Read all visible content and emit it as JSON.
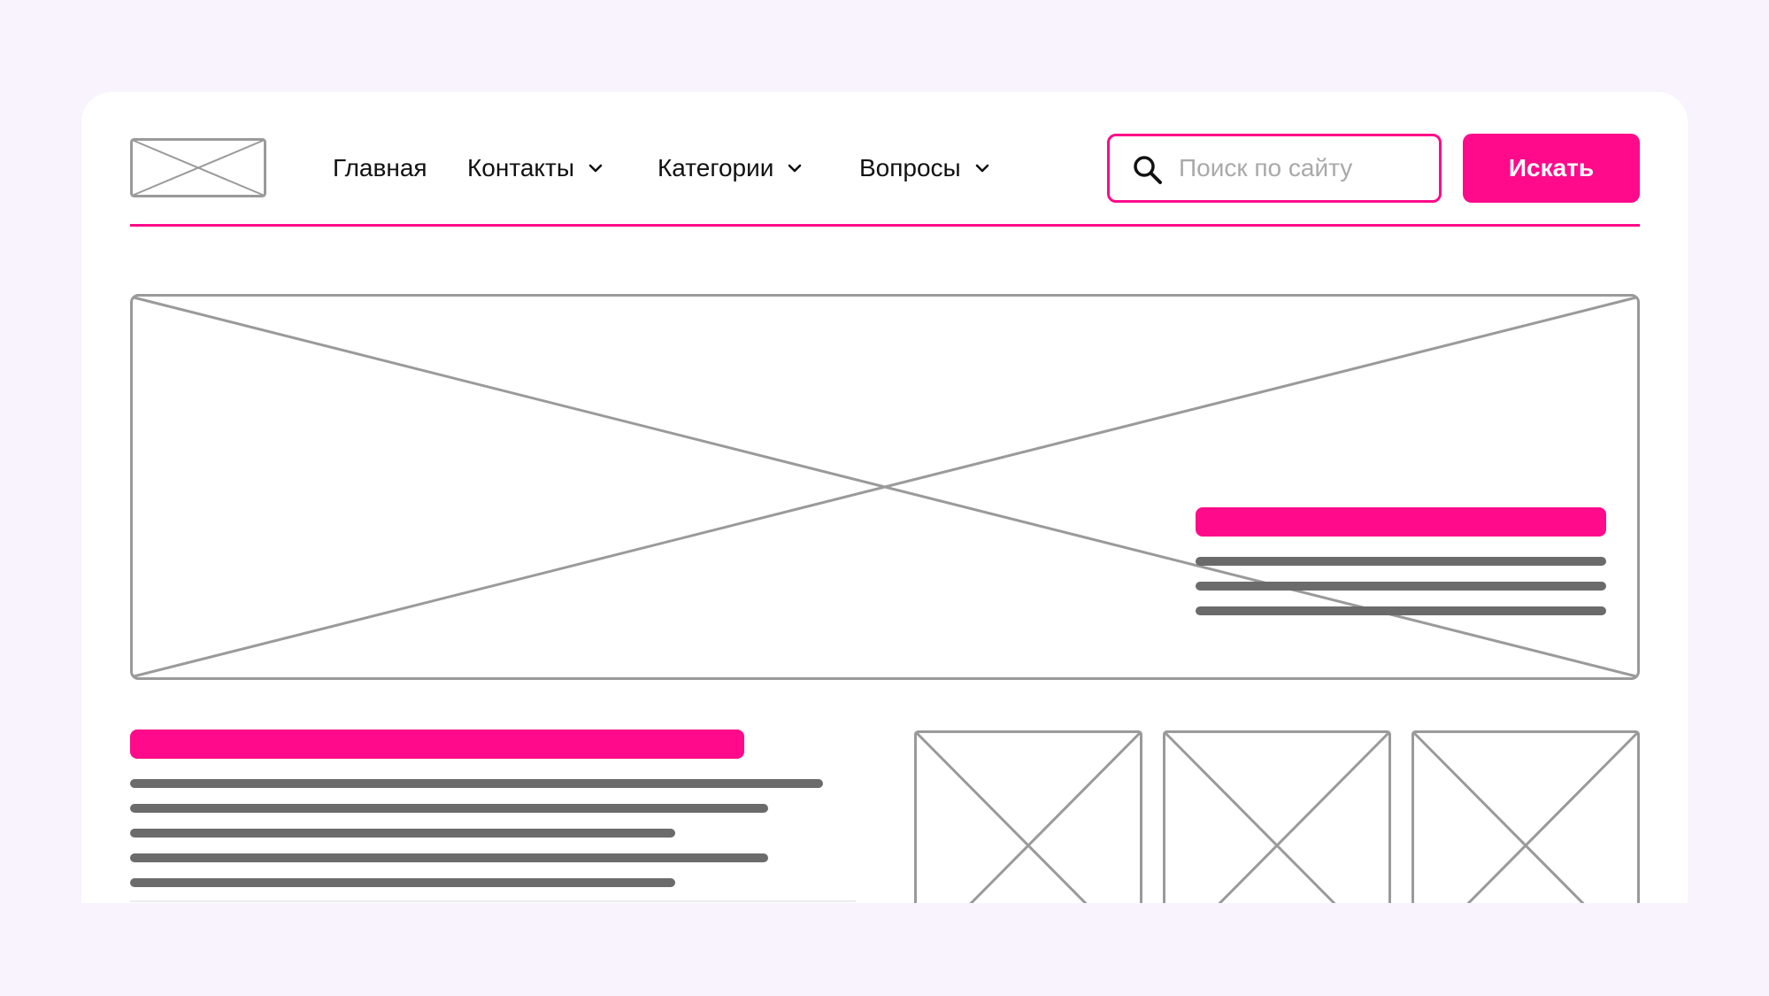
{
  "colors": {
    "page_background": "#f9f3fd",
    "card_background": "#ffffff",
    "accent": "#ff0a8a",
    "placeholder_stroke": "#9a9a9a",
    "text_line": "#6b6b6b"
  },
  "header": {
    "logo_icon": "image-placeholder-icon",
    "nav": [
      {
        "label": "Главная",
        "has_dropdown": false
      },
      {
        "label": "Контакты",
        "has_dropdown": true
      },
      {
        "label": "Категории",
        "has_dropdown": true
      },
      {
        "label": "Вопросы",
        "has_dropdown": true
      }
    ],
    "search": {
      "icon": "search-icon",
      "value": "",
      "placeholder": "Поиск по сайту",
      "button_label": "Искать"
    }
  },
  "hero": {
    "image_icon": "image-placeholder-icon",
    "text_block": {
      "heading": "pink-bar",
      "line_count": 3
    }
  },
  "content": {
    "text_block": {
      "heading": "pink-bar",
      "line_count": 5
    },
    "thumbnails": [
      {
        "icon": "image-placeholder-icon"
      },
      {
        "icon": "image-placeholder-icon"
      },
      {
        "icon": "image-placeholder-icon"
      }
    ]
  }
}
